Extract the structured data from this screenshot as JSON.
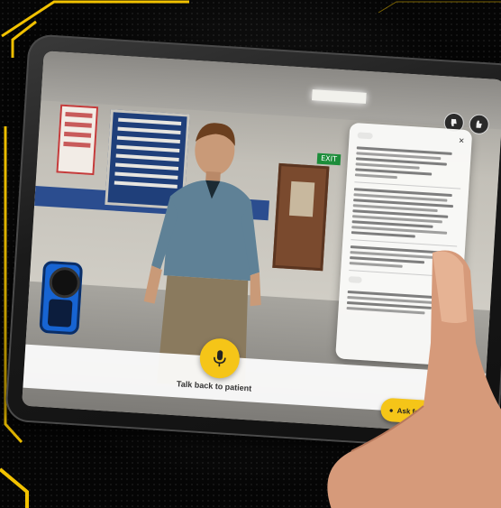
{
  "scene": {
    "exit_sign": "EXIT"
  },
  "ui": {
    "talk_back_label": "Talk back to patient",
    "ask_advice_label": "Ask for advice",
    "mic_icon": "microphone-icon",
    "panel": {
      "close_icon": "close-icon"
    },
    "top_icons": [
      "thumbs-down-icon",
      "thumbs-up-icon"
    ]
  },
  "colors": {
    "accent_yellow": "#f5c518",
    "device_blue": "#1764d2",
    "hud_yellow": "#f2c200"
  }
}
